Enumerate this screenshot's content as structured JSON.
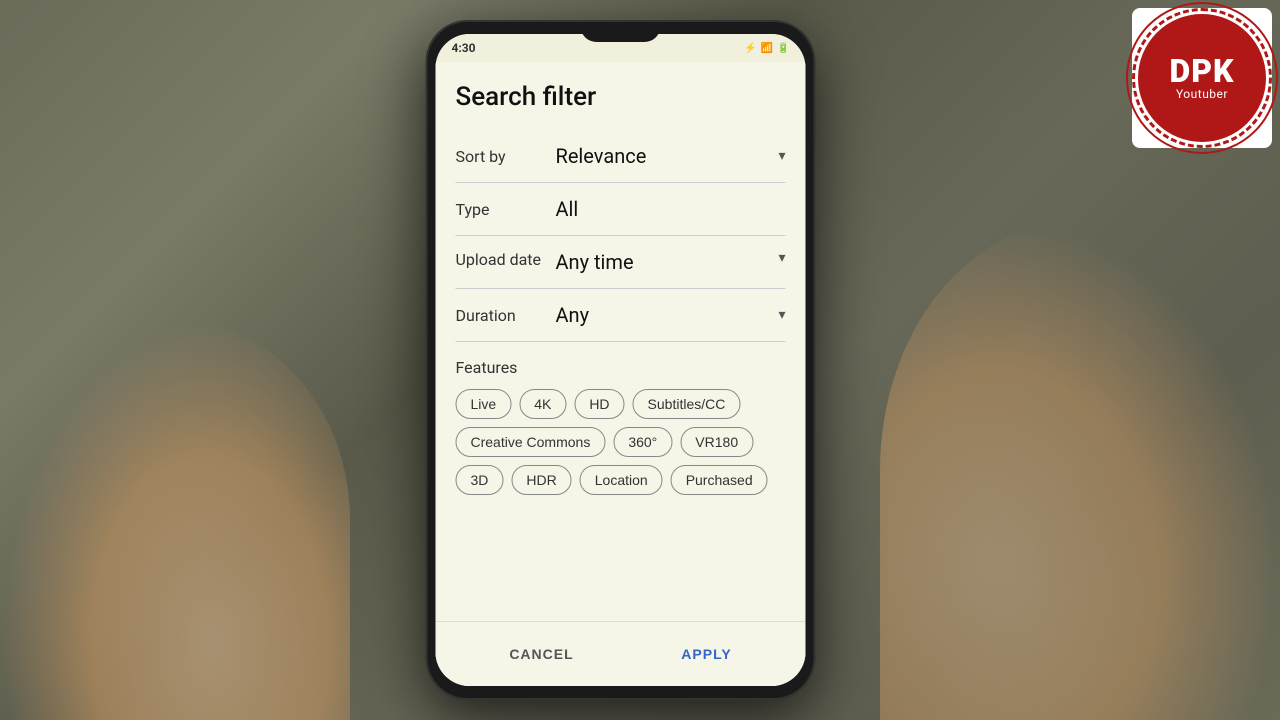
{
  "background": {
    "color": "#5a5a4a"
  },
  "status_bar": {
    "time": "4:30",
    "icons": "🔵 📶 🔋"
  },
  "filter": {
    "title": "Search filter",
    "sort_by": {
      "label": "Sort by",
      "value": "Relevance"
    },
    "type": {
      "label": "Type",
      "value": "All"
    },
    "upload_date": {
      "label": "Upload date",
      "value": "Any time"
    },
    "duration": {
      "label": "Duration",
      "value": "Any"
    },
    "features": {
      "label": "Features",
      "chips": [
        "Live",
        "4K",
        "HD",
        "Subtitles/CC",
        "Creative Commons",
        "360°",
        "VR180",
        "3D",
        "HDR",
        "Location",
        "Purchased"
      ]
    }
  },
  "buttons": {
    "cancel": "CANCEL",
    "apply": "APPLY"
  },
  "logo": {
    "main": "DPK",
    "sub": "Youtuber"
  }
}
